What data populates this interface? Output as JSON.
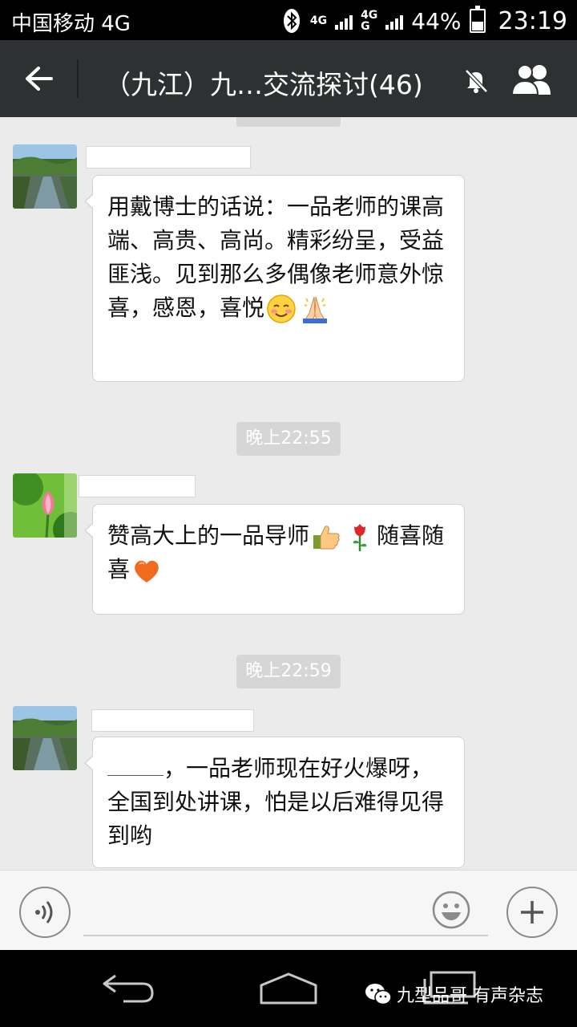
{
  "status_bar": {
    "carrier": "中国移动 4G",
    "network_1": "4G",
    "network_2_top": "4G",
    "network_2_bottom": "G",
    "battery": "44%",
    "battery_level": 0.44,
    "time": "23:19"
  },
  "header": {
    "title": "（九江）九…交流探讨(46)"
  },
  "messages": [
    {
      "avatar": "river-landscape",
      "text": "用戴博士的话说：一品老师的课高端、高贵、高尚。精彩纷呈，受益匪浅。见到那么多偶像老师意外惊喜，感恩，喜悦",
      "emojis": [
        "blush-emoji",
        "pray-emoji"
      ]
    },
    {
      "time": "晚上22:55"
    },
    {
      "avatar": "lotus-flower",
      "text_a": "赞高大上的一品导师",
      "text_b": "随喜随喜",
      "emojis": [
        "thumbs-up-emoji",
        "rose-emoji",
        "heart-emoji"
      ]
    },
    {
      "time": "晚上22:59"
    },
    {
      "avatar": "river-landscape",
      "text": "，一品老师现在好火爆呀，全国到处讲课，怕是以后难得见得到哟"
    }
  ],
  "input": {
    "value": "",
    "placeholder": ""
  },
  "watermark": "九型品哥 有声杂志",
  "colors": {
    "title_bar": "#2e3132",
    "chat_bg": "#ebebeb",
    "time_pill": "#d6d6d6"
  }
}
